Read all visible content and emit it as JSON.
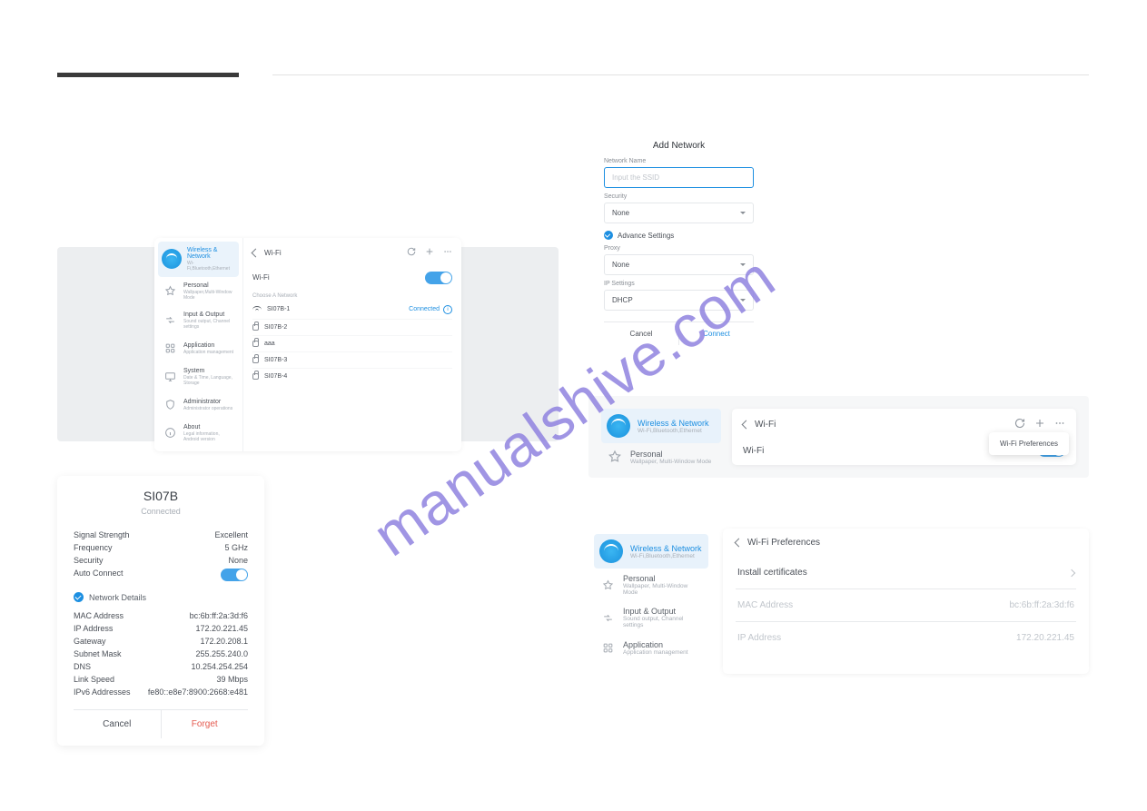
{
  "watermark": "manualshive.com",
  "panelA": {
    "sidebar": {
      "wireless": {
        "title": "Wireless & Network",
        "sub": "Wi-Fi,Bluetooth,Ethernet"
      },
      "items": [
        {
          "icon": "star",
          "title": "Personal",
          "sub": "Wallpaper,Multi-Window Mode"
        },
        {
          "icon": "io",
          "title": "Input & Output",
          "sub": "Sound output, Channel settings"
        },
        {
          "icon": "grid",
          "title": "Application",
          "sub": "Application management"
        },
        {
          "icon": "mon",
          "title": "System",
          "sub": "Date & Time, Language, Storage"
        },
        {
          "icon": "shield",
          "title": "Administrator",
          "sub": "Administrator operations"
        },
        {
          "icon": "info",
          "title": "About",
          "sub": "Legal information, Android version"
        }
      ]
    },
    "header": "Wi-Fi",
    "wifiRow": "Wi-Fi",
    "choose": "Choose A Network",
    "networks": [
      {
        "name": "SI07B-1",
        "locked": false,
        "status": "Connected"
      },
      {
        "name": "SI07B-2",
        "locked": true
      },
      {
        "name": "aaa",
        "locked": true
      },
      {
        "name": "SI07B-3",
        "locked": true
      },
      {
        "name": "SI07B-4",
        "locked": true
      }
    ]
  },
  "panelB": {
    "title": "SI07B",
    "status": "Connected",
    "top": [
      {
        "k": "Signal Strength",
        "v": "Excellent"
      },
      {
        "k": "Frequency",
        "v": "5 GHz"
      },
      {
        "k": "Security",
        "v": "None"
      }
    ],
    "auto": "Auto Connect",
    "ndLabel": "Network Details",
    "details": [
      {
        "k": "MAC Address",
        "v": "bc:6b:ff:2a:3d:f6"
      },
      {
        "k": "IP Address",
        "v": "172.20.221.45"
      },
      {
        "k": "Gateway",
        "v": "172.20.208.1"
      },
      {
        "k": "Subnet Mask",
        "v": "255.255.240.0"
      },
      {
        "k": "DNS",
        "v": "10.254.254.254"
      },
      {
        "k": "Link Speed",
        "v": "39 Mbps"
      },
      {
        "k": "IPv6 Addresses",
        "v": "fe80::e8e7:8900:2668:e481"
      }
    ],
    "cancel": "Cancel",
    "forget": "Forget"
  },
  "panelC": {
    "title": "Add Network",
    "nameLabel": "Network Name",
    "namePlaceholder": "Input the SSID",
    "secLabel": "Security",
    "secVal": "None",
    "advLabel": "Advance Settings",
    "proxyLabel": "Proxy",
    "proxyVal": "None",
    "ipLabel": "IP Settings",
    "ipVal": "DHCP",
    "cancel": "Cancel",
    "connect": "Connect"
  },
  "panelD": {
    "wireless": {
      "title": "Wireless & Network",
      "sub": "Wi-Fi,Bluetooth,Ethernet"
    },
    "personal": {
      "title": "Personal",
      "sub": "Wallpaper, Multi-Window Mode"
    },
    "header": "Wi-Fi",
    "row": "Wi-Fi",
    "tooltip": "Wi-Fi Preferences"
  },
  "panelE": {
    "wireless": {
      "title": "Wireless & Network",
      "sub": "Wi-Fi,Bluetooth,Ethernet"
    },
    "items": [
      {
        "title": "Personal",
        "sub": "Wallpaper, Multi-Window Mode",
        "icon": "star"
      },
      {
        "title": "Input & Output",
        "sub": "Sound output, Channel settings",
        "icon": "io"
      },
      {
        "title": "Application",
        "sub": "Application management",
        "icon": "grid"
      }
    ],
    "header": "Wi-Fi Preferences",
    "rows": [
      {
        "k": "Install certificates",
        "v": "",
        "chev": true
      },
      {
        "k": "MAC Address",
        "v": "bc:6b:ff:2a:3d:f6",
        "muted": true
      },
      {
        "k": "IP Address",
        "v": "172.20.221.45",
        "muted": true
      }
    ]
  }
}
